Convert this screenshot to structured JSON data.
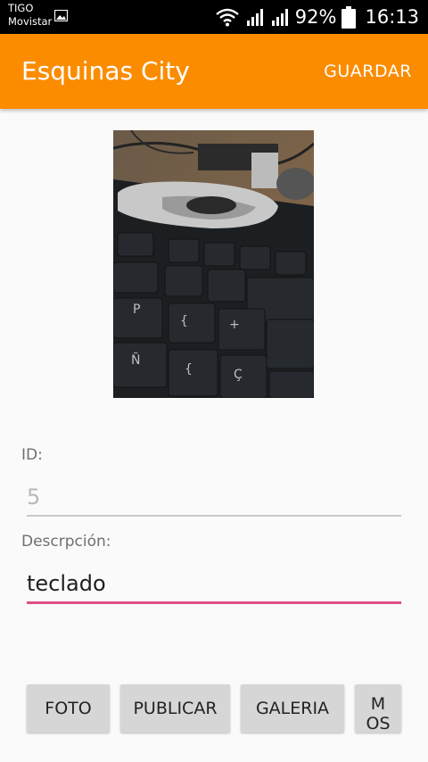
{
  "status_bar": {
    "carrier_line1": "TIGO",
    "carrier_line2": "Movistar",
    "battery": "92%",
    "time": "16:13",
    "icons": [
      "gallery-icon",
      "wifi-icon",
      "signal-icon",
      "signal-icon",
      "battery-icon"
    ]
  },
  "app_bar": {
    "title": "Esquinas City",
    "save_label": "GUARDAR",
    "color": "#fb8c00"
  },
  "form": {
    "id_label": "ID:",
    "id_value": "5",
    "description_label": "Descrpción:",
    "description_value": "teclado",
    "accent_color": "#e04f86"
  },
  "buttons": {
    "foto": "FOTO",
    "publicar": "PUBLICAR",
    "galeria": "GALERIA",
    "more_line1": "M",
    "more_line2": "OS"
  }
}
